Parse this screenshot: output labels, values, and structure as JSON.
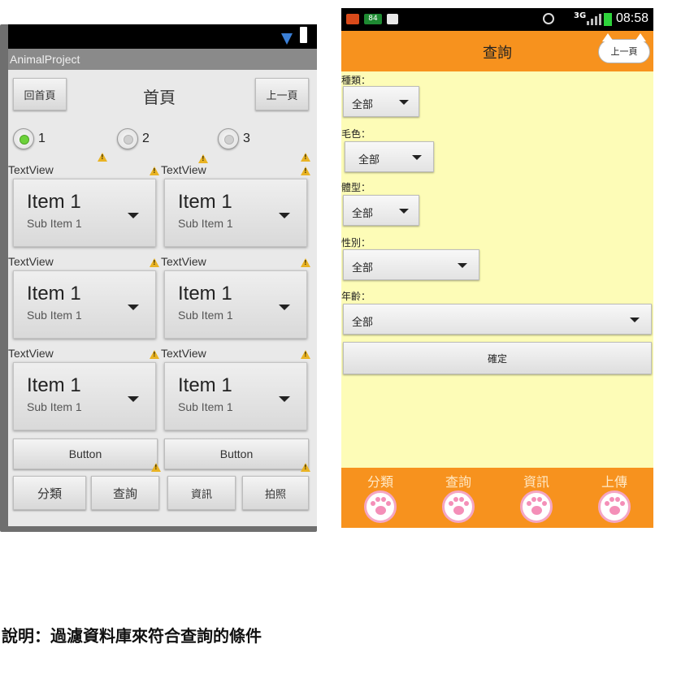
{
  "left_phone": {
    "app_title": "AnimalProject",
    "home_button": "回首頁",
    "heading": "首頁",
    "back_button": "上一頁",
    "radios": [
      {
        "label": "1",
        "selected": true
      },
      {
        "label": "2",
        "selected": false
      },
      {
        "label": "3",
        "selected": false
      }
    ],
    "rows": [
      {
        "left_label": "TextView",
        "right_label": "TextView",
        "left_item": "Item 1",
        "left_sub": "Sub Item 1",
        "right_item": "Item 1",
        "right_sub": "Sub Item 1"
      },
      {
        "left_label": "TextView",
        "right_label": "TextView",
        "left_item": "Item 1",
        "left_sub": "Sub Item 1",
        "right_item": "Item 1",
        "right_sub": "Sub Item 1"
      },
      {
        "left_label": "TextView",
        "right_label": "TextView",
        "left_item": "Item 1",
        "left_sub": "Sub Item 1",
        "right_item": "Item 1",
        "right_sub": "Sub Item 1"
      }
    ],
    "buttons": [
      "Button",
      "Button"
    ],
    "tabs": [
      "分類",
      "查詢",
      "資訊",
      "拍照"
    ]
  },
  "right_phone": {
    "status": {
      "time": "08:58",
      "network": "3G",
      "badge": "84"
    },
    "title": "查詢",
    "back_button": "上一頁",
    "filters": [
      {
        "label": "種類：",
        "value": "全部"
      },
      {
        "label": "毛色：",
        "value": "全部"
      },
      {
        "label": "體型：",
        "value": "全部"
      },
      {
        "label": "性別：",
        "value": "全部"
      },
      {
        "label": "年齡：",
        "value": "全部"
      }
    ],
    "confirm_button": "確定",
    "nav": [
      "分類",
      "查詢",
      "資訊",
      "上傳"
    ]
  },
  "caption": "說明：過濾資料庫來符合查詢的條件",
  "colors": {
    "accent_orange": "#f7921e",
    "panel_yellow": "#fdfcb7",
    "radio_green": "#6cd23a"
  }
}
